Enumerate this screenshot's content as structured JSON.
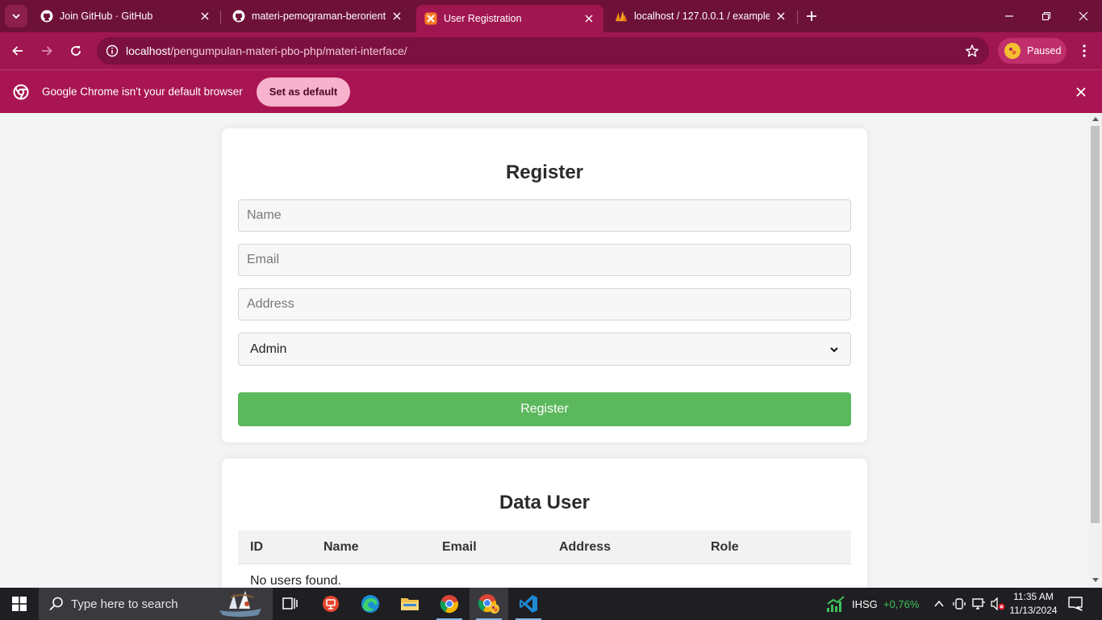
{
  "browser": {
    "tabs": [
      {
        "title": "Join GitHub · GitHub",
        "icon": "github-icon"
      },
      {
        "title": "materi-pemograman-berorientasi",
        "icon": "github-icon"
      },
      {
        "title": "User Registration",
        "icon": "xampp-icon",
        "active": true
      },
      {
        "title": "localhost / 127.0.0.1 / example",
        "icon": "phpmyadmin-icon"
      }
    ],
    "url_host": "localhost",
    "url_path": "/pengumpulan-materi-pbo-php/materi-interface/",
    "profile_label": "Paused",
    "infobar_text": "Google Chrome isn't your default browser",
    "set_default_label": "Set as default"
  },
  "register": {
    "title": "Register",
    "name_placeholder": "Name",
    "email_placeholder": "Email",
    "address_placeholder": "Address",
    "role_selected": "Admin",
    "submit_label": "Register"
  },
  "data_user": {
    "title": "Data User",
    "columns": [
      "ID",
      "Name",
      "Email",
      "Address",
      "Role"
    ],
    "empty_message": "No users found."
  },
  "taskbar": {
    "search_placeholder": "Type here to search",
    "stock_name": "IHSG",
    "stock_change": "+0,76%",
    "time": "11:35 AM",
    "date": "11/13/2024"
  },
  "colors": {
    "chrome_frame": "#6e1138",
    "chrome_toolbar": "#a01650",
    "register_button": "#5cb85c",
    "stock_up": "#3ec15b"
  }
}
